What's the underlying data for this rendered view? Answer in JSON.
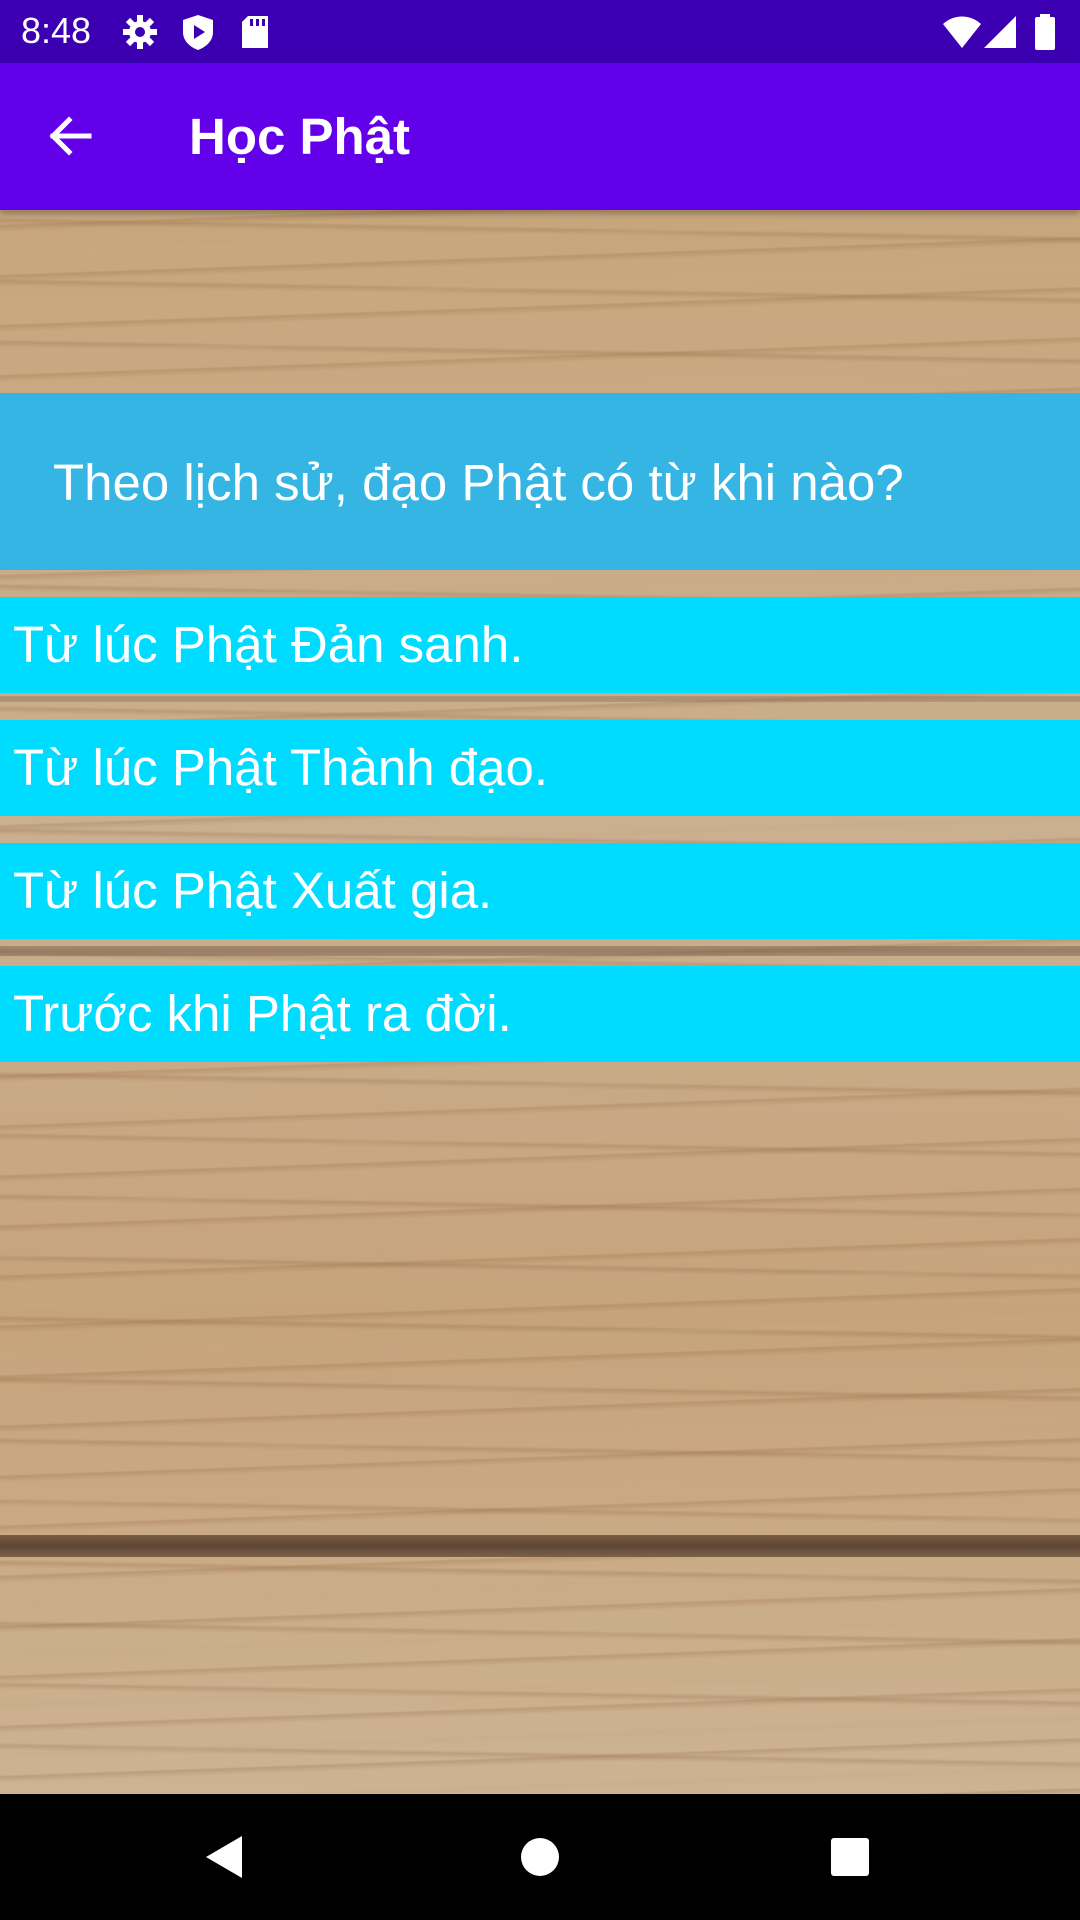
{
  "status_bar": {
    "time": "8:48",
    "icons": [
      "gear-icon",
      "shield-play-icon",
      "sd-card-icon",
      "wifi-icon",
      "signal-icon",
      "battery-icon"
    ]
  },
  "app_bar": {
    "title": "Học Phật",
    "back_icon": "arrow-left-icon"
  },
  "quiz": {
    "question": "Theo lịch sử, đạo Phật có từ khi nào?",
    "answers": [
      "Từ lúc Phật Đản sanh.",
      "Từ lúc Phật Thành đạo.",
      "Từ lúc Phật Xuất gia.",
      "Trước khi Phật ra đời."
    ]
  },
  "nav_bar": {
    "buttons": [
      "back-triangle-icon",
      "home-circle-icon",
      "recents-square-icon"
    ]
  },
  "colors": {
    "status_bar": "#3c00b2",
    "app_bar": "#6200ea",
    "question_bg": "#35b5e3",
    "answer_bg": "#00dcff",
    "wood": "#c9a87f"
  }
}
